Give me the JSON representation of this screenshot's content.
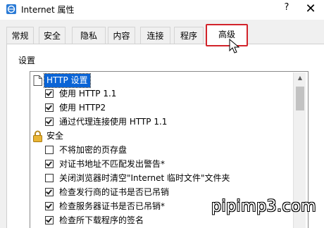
{
  "window": {
    "title": "Internet 属性",
    "help_label": "?",
    "close_label": "✕"
  },
  "tabs": [
    {
      "label": "常规",
      "selected": false
    },
    {
      "label": "安全",
      "selected": false
    },
    {
      "label": "隐私",
      "selected": false
    },
    {
      "label": "内容",
      "selected": false
    },
    {
      "label": "连接",
      "selected": false
    },
    {
      "label": "程序",
      "selected": false
    },
    {
      "label": "高级",
      "selected": true
    }
  ],
  "settings": {
    "label": "设置",
    "groups": [
      {
        "label": "HTTP 设置",
        "icon": "document-icon",
        "items": [
          {
            "label": "使用 HTTP 1.1",
            "checked": true
          },
          {
            "label": "使用 HTTP2",
            "checked": true
          },
          {
            "label": "通过代理连接使用 HTTP 1.1",
            "checked": true
          }
        ]
      },
      {
        "label": "安全",
        "icon": "lock-icon",
        "items": [
          {
            "label": "不将加密的页存盘",
            "checked": false
          },
          {
            "label": "对证书地址不匹配发出警告*",
            "checked": true
          },
          {
            "label": "关闭浏览器时清空\"Internet 临时文件\"文件夹",
            "checked": false
          },
          {
            "label": "检查发行商的证书是否已吊销",
            "checked": true
          },
          {
            "label": "检查服务器证书是否已吊销*",
            "checked": true
          },
          {
            "label": "检查所下载程序的签名",
            "checked": true
          }
        ]
      }
    ]
  },
  "watermark": "pipimp3.com",
  "colors": {
    "highlight": "#0a64d6",
    "annotation_box": "#d2232a"
  }
}
